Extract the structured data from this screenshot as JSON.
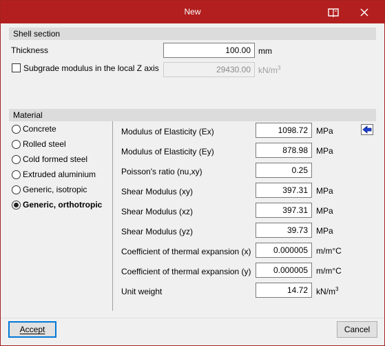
{
  "window": {
    "title": "New"
  },
  "shell_section": {
    "header": "Shell section",
    "thickness_label": "Thickness",
    "thickness_value": "100.00",
    "thickness_unit": "mm",
    "subgrade_label": "Subgrade modulus in the local Z axis",
    "subgrade_checked": false,
    "subgrade_value": "29430.00",
    "subgrade_unit": "kN/m",
    "subgrade_unit_sup": "3"
  },
  "material": {
    "header": "Material",
    "options": [
      {
        "label": "Concrete",
        "selected": false
      },
      {
        "label": "Rolled steel",
        "selected": false
      },
      {
        "label": "Cold formed steel",
        "selected": false
      },
      {
        "label": "Extruded aluminium",
        "selected": false
      },
      {
        "label": "Generic, isotropic",
        "selected": false
      },
      {
        "label": "Generic, orthotropic",
        "selected": true
      }
    ],
    "properties": [
      {
        "label": "Modulus of Elasticity (Ex)",
        "value": "1098.72",
        "unit": "MPa",
        "sup": ""
      },
      {
        "label": "Modulus of Elasticity (Ey)",
        "value": "878.98",
        "unit": "MPa",
        "sup": ""
      },
      {
        "label": "Poisson's ratio (nu,xy)",
        "value": "0.25",
        "unit": "",
        "sup": ""
      },
      {
        "label": "Shear Modulus (xy)",
        "value": "397.31",
        "unit": "MPa",
        "sup": ""
      },
      {
        "label": "Shear Modulus (xz)",
        "value": "397.31",
        "unit": "MPa",
        "sup": ""
      },
      {
        "label": "Shear Modulus (yz)",
        "value": "39.73",
        "unit": "MPa",
        "sup": ""
      },
      {
        "label": "Coefficient of thermal expansion (x)",
        "value": "0.000005",
        "unit": "m/m°C",
        "sup": ""
      },
      {
        "label": "Coefficient of thermal expansion (y)",
        "value": "0.000005",
        "unit": "m/m°C",
        "sup": ""
      },
      {
        "label": "Unit weight",
        "value": "14.72",
        "unit": "kN/m",
        "sup": "3"
      }
    ]
  },
  "buttons": {
    "accept": "Accept",
    "cancel": "Cancel"
  },
  "icons": {
    "help": "book-icon",
    "close": "close-icon",
    "back": "arrow-left-icon"
  },
  "colors": {
    "titlebar": "#b31f1f",
    "accent": "#0078d7",
    "arrow": "#1a3fd6"
  }
}
